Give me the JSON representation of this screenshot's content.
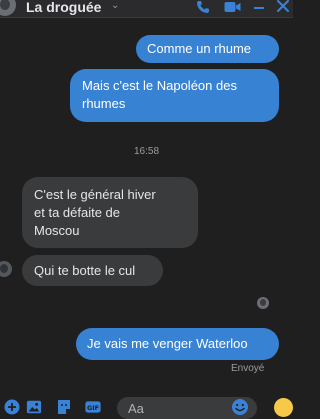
{
  "header": {
    "title": "La droguée"
  },
  "messages": [
    {
      "id": "m1",
      "sender": "me",
      "text": "Comme un rhume"
    },
    {
      "id": "m2",
      "sender": "me",
      "lines": [
        "Mais c'est le Napoléon des",
        "rhumes"
      ]
    },
    {
      "id": "m3",
      "sender": "them",
      "lines": [
        "C'est le général hiver",
        "et ta défaite de",
        "Moscou"
      ]
    },
    {
      "id": "m4",
      "sender": "them",
      "text": "Qui te botte le cul"
    },
    {
      "id": "m5",
      "sender": "me",
      "text": "Je vais me venger Waterloo"
    }
  ],
  "timestamp": "16:58",
  "status": "Envoyé",
  "composer": {
    "placeholder": "Aa"
  },
  "colors": {
    "outgoing_bubble": "#3882d4",
    "incoming_bubble": "#3a3b3c",
    "background": "#1f1f20",
    "icon_blue": "#3a82d6",
    "like": "#f7c948"
  },
  "icons": [
    "phone-icon",
    "video-camera-icon",
    "minimize-icon",
    "close-icon",
    "add-icon",
    "image-icon",
    "sticker-icon",
    "gif-icon",
    "emoji-icon",
    "like-icon"
  ]
}
